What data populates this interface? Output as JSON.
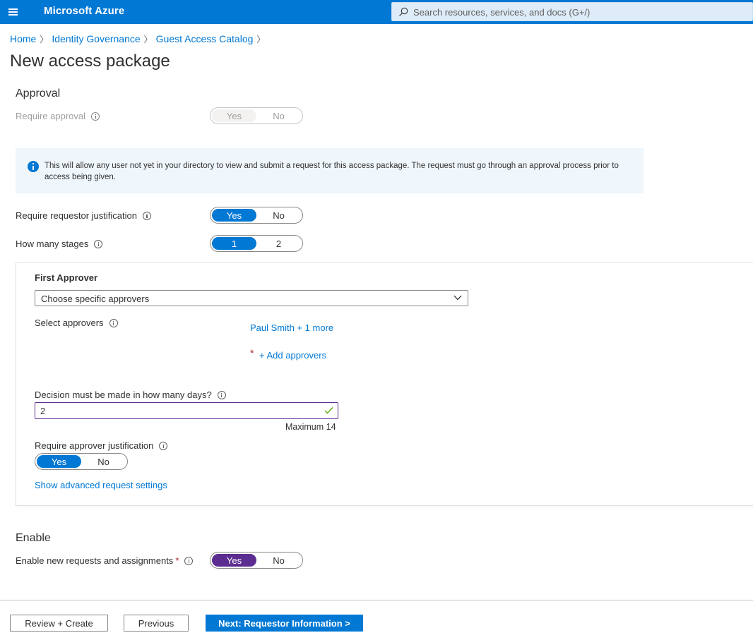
{
  "topbar": {
    "brand": "Microsoft Azure",
    "search_placeholder": "Search resources, services, and docs (G+/)"
  },
  "breadcrumb": [
    "Home",
    "Identity Governance",
    "Guest Access Catalog"
  ],
  "page_title": "New access package",
  "approval": {
    "section_title": "Approval",
    "require_approval": {
      "label": "Require approval",
      "options": [
        "Yes",
        "No"
      ],
      "selected": "Yes",
      "disabled": true
    },
    "banner_text": "This will allow any user not yet in your directory to view and submit a request for this access package. The request must go through an approval process prior to access being given.",
    "requestor_justification": {
      "label": "Require requestor justification",
      "options": [
        "Yes",
        "No"
      ],
      "selected": "Yes"
    },
    "stages": {
      "label": "How many stages",
      "options": [
        "1",
        "2"
      ],
      "selected": "1"
    }
  },
  "first_approver": {
    "title": "First Approver",
    "dropdown_value": "Choose specific approvers",
    "select_label": "Select approvers",
    "approvers_link": "Paul Smith + 1 more",
    "add_link": "+ Add approvers",
    "required_star": "*",
    "days_label": "Decision must be made in how many days?",
    "days_value": "2",
    "max_text": "Maximum 14",
    "approver_justification": {
      "label": "Require approver justification",
      "options": [
        "Yes",
        "No"
      ],
      "selected": "Yes"
    },
    "advanced_link": "Show advanced request settings"
  },
  "enable": {
    "section_title": "Enable",
    "label": "Enable new requests and assignments",
    "required_star": "*",
    "options": [
      "Yes",
      "No"
    ],
    "selected": "Yes"
  },
  "footer": {
    "review_create": "Review + Create",
    "previous": "Previous",
    "next": "Next: Requestor Information >"
  },
  "colors": {
    "accent": "#0078d4",
    "enable_toggle": "#5c2d91",
    "banner_bg": "#eff6fc"
  }
}
